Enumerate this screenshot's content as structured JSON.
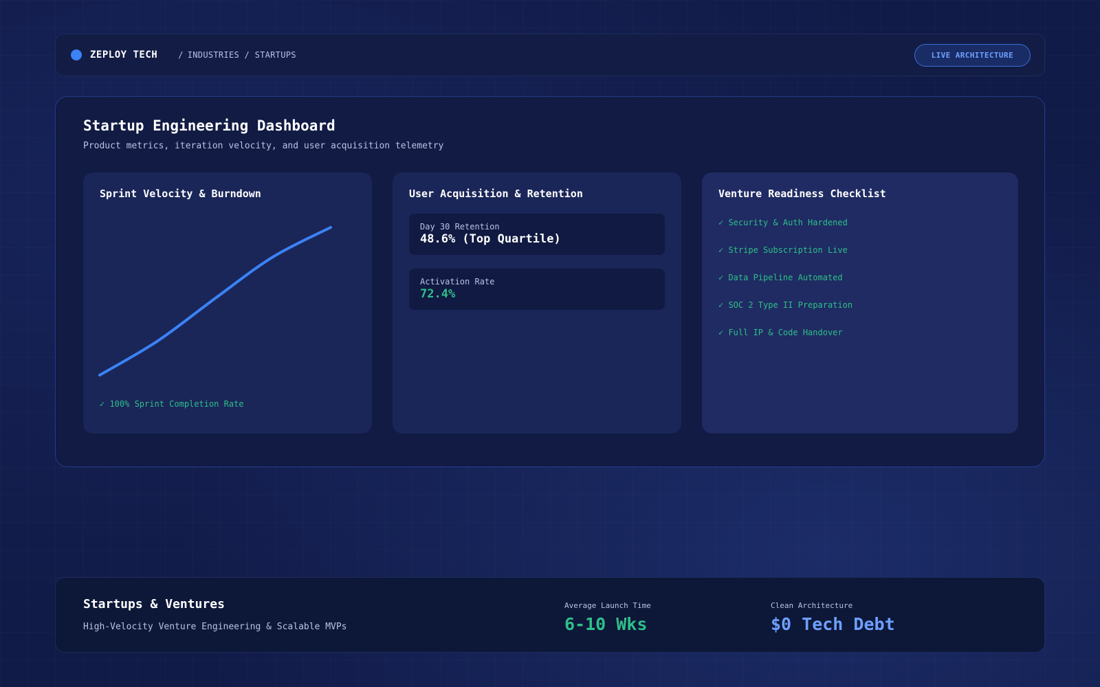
{
  "nav": {
    "brand": "ZEPLOY TECH",
    "breadcrumb": "INDUSTRIES / STARTUPS",
    "breadcrumb_sep": "/",
    "live_button": "LIVE ARCHITECTURE"
  },
  "dashboard": {
    "title": "Startup Engineering Dashboard",
    "subtitle": "Product metrics, iteration velocity, and user acquisition telemetry"
  },
  "velocity": {
    "title": "Sprint Velocity & Burndown",
    "footnote": "✓ 100% Sprint Completion Rate",
    "line_color": "#3b82f6"
  },
  "chart_data": {
    "type": "line",
    "title": "Sprint Velocity & Burndown",
    "xlabel": "",
    "ylabel": "",
    "grid": false,
    "x": [
      0,
      1,
      2,
      3,
      4
    ],
    "series": [
      {
        "values": [
          0,
          0.23,
          0.52,
          0.8,
          1.0
        ]
      }
    ],
    "xlim": [
      0,
      4
    ],
    "ylim": [
      0,
      1
    ]
  },
  "acquisition": {
    "title": "User Acquisition & Retention",
    "metrics": [
      {
        "label": "Day 30 Retention",
        "value": "48.6% (Top Quartile)"
      },
      {
        "label": "Activation Rate",
        "value": "72.4%"
      }
    ]
  },
  "checklist": {
    "title": "Venture Readiness Checklist",
    "items": [
      "✓ Security & Auth Hardened",
      "✓ Stripe Subscription Live",
      "✓ Data Pipeline Automated",
      "✓ SOC 2 Type II Preparation",
      "✓ Full IP & Code Handover"
    ]
  },
  "footer": {
    "title": "Startups & Ventures",
    "subtitle": "High-Velocity Venture Engineering & Scalable MVPs",
    "stats": [
      {
        "label": "Average Launch Time",
        "value": "6-10 Wks"
      },
      {
        "label": "Clean Architecture",
        "value": "$0 Tech Debt"
      }
    ]
  },
  "colors": {
    "accent": "#3b82f6",
    "success": "#2fbf8a",
    "link": "#6ea0ff",
    "background": "#111b48"
  }
}
